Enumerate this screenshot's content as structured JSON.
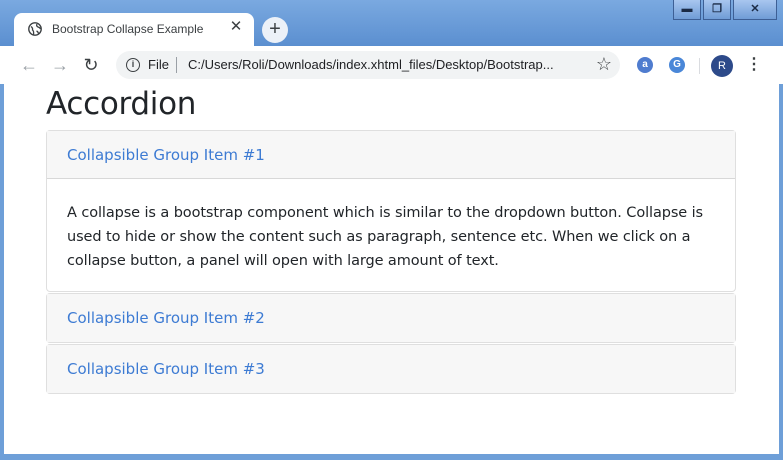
{
  "browser": {
    "tab": {
      "title": "Bootstrap Collapse Example",
      "close_glyph": "✕"
    },
    "new_tab_glyph": "+",
    "window_controls": {
      "minimize": "▬",
      "maximize": "❐",
      "close": "✕"
    },
    "toolbar": {
      "back_glyph": "←",
      "forward_glyph": "→",
      "reload_glyph": "↻",
      "info_glyph": "i",
      "scheme_label": "File",
      "url": "C:/Users/Roli/Downloads/index.xhtml_files/Desktop/Bootstrap...",
      "star_glyph": "☆",
      "extension1_glyph": "a",
      "extension2_glyph": "G",
      "profile_initial": "R",
      "menu_glyph": "⋮"
    },
    "colors": {
      "frame": "#6e9fd8",
      "profile": "#2d4a8a",
      "extension1": "#4f7ccf",
      "extension2": "#4a87d8"
    }
  },
  "page": {
    "title": "Accordion",
    "link_color": "#3d7bd3",
    "cards": [
      {
        "header": "Collapsible Group Item #1",
        "expanded": true,
        "body": "A collapse is a bootstrap component which is similar to the dropdown button. Collapse is used to hide or show the content such as paragraph, sentence etc. When we click on a collapse button, a panel will open with large amount of text."
      },
      {
        "header": "Collapsible Group Item #2",
        "expanded": false
      },
      {
        "header": "Collapsible Group Item #3",
        "expanded": false
      }
    ]
  }
}
